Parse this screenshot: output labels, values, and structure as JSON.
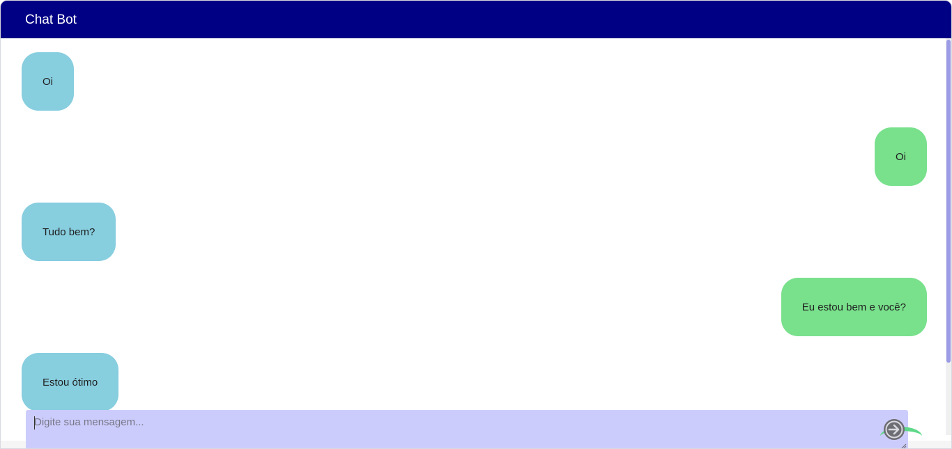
{
  "header": {
    "title": "Chat Bot"
  },
  "messages": [
    {
      "sender": "bot",
      "text": "Oi"
    },
    {
      "sender": "user",
      "text": "Oi"
    },
    {
      "sender": "bot",
      "text": "Tudo bem?"
    },
    {
      "sender": "user",
      "text": "Eu estou bem e você?"
    },
    {
      "sender": "bot",
      "text": "Estou ótimo"
    }
  ],
  "composer": {
    "value": "",
    "placeholder": "Digite sua mensagem...",
    "send_icon": "arrow-right-circle-icon"
  },
  "colors": {
    "header_bg": "#000084",
    "bot_bubble": "#87cedf",
    "user_bubble": "#79e08c",
    "input_bg": "#ccccfc",
    "scroll_thumb": "#9b9be6"
  }
}
